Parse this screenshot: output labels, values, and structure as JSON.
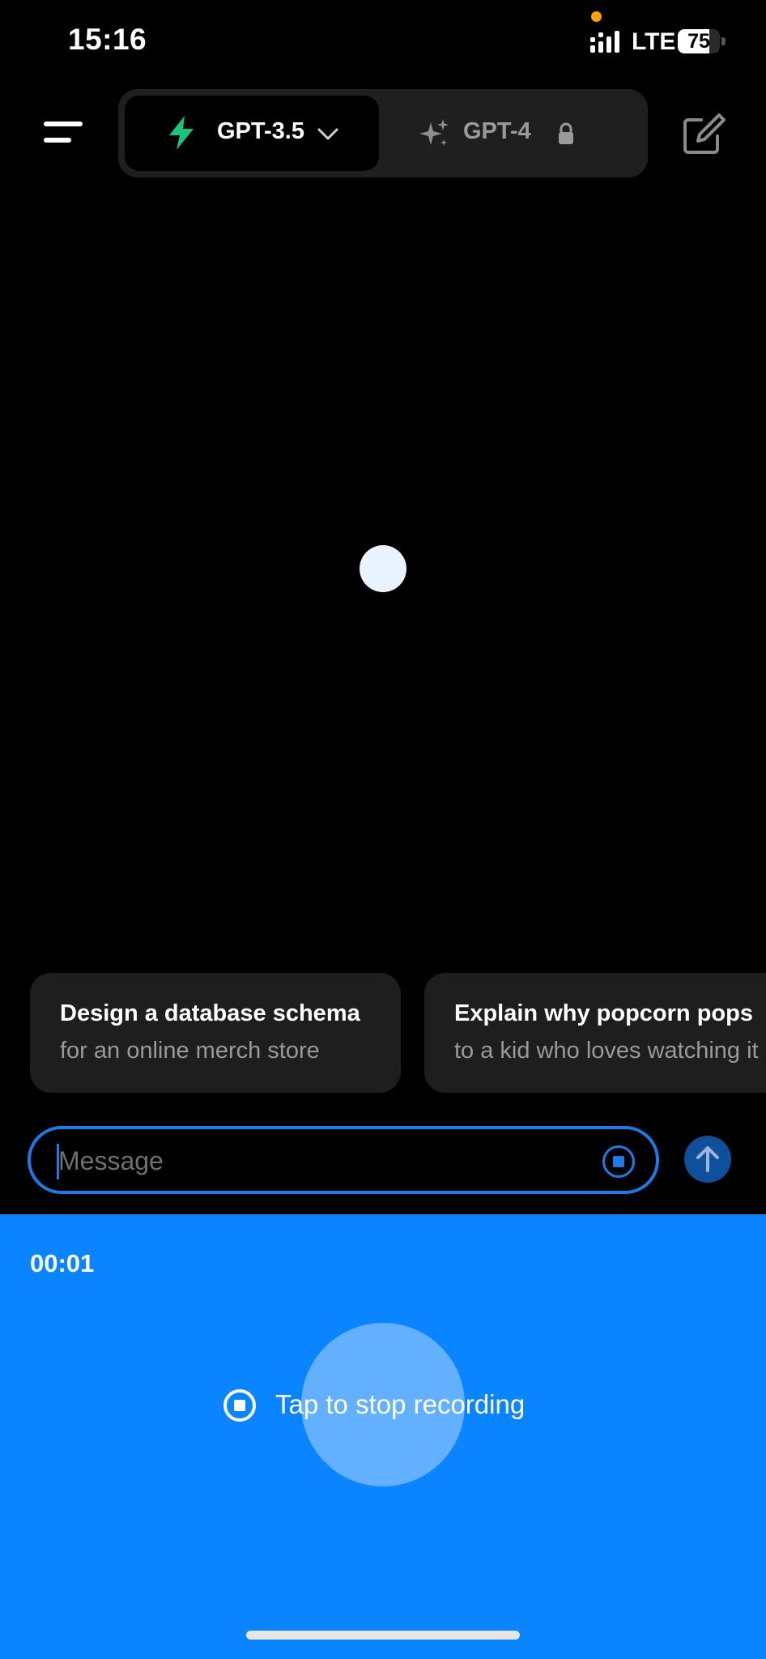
{
  "status_bar": {
    "time": "15:16",
    "network": "LTE",
    "battery": "75",
    "battery_level": 0.75,
    "privacy_dot_color": "#ff9f0a"
  },
  "header": {
    "menu_icon": "menu-icon",
    "models": [
      {
        "label": "GPT-3.5",
        "icon": "bolt-icon",
        "accent": "#19c37d",
        "selected": true,
        "trailing_icon": "chevron-down-icon"
      },
      {
        "label": "GPT-4",
        "icon": "sparkles-icon",
        "selected": false,
        "trailing_icon": "lock-icon"
      }
    ],
    "new_chat_icon": "compose-icon"
  },
  "suggestions": [
    {
      "title": "Design a database schema",
      "subtitle": "for an online merch store"
    },
    {
      "title": "Explain why popcorn pops",
      "subtitle": "to a kid who loves watching it in the microwave"
    }
  ],
  "composer": {
    "placeholder": "Message",
    "accent": "#1f7ae8"
  },
  "recording": {
    "timer": "00:01",
    "stop_label": "Tap to stop recording",
    "background": "#0a84ff"
  }
}
